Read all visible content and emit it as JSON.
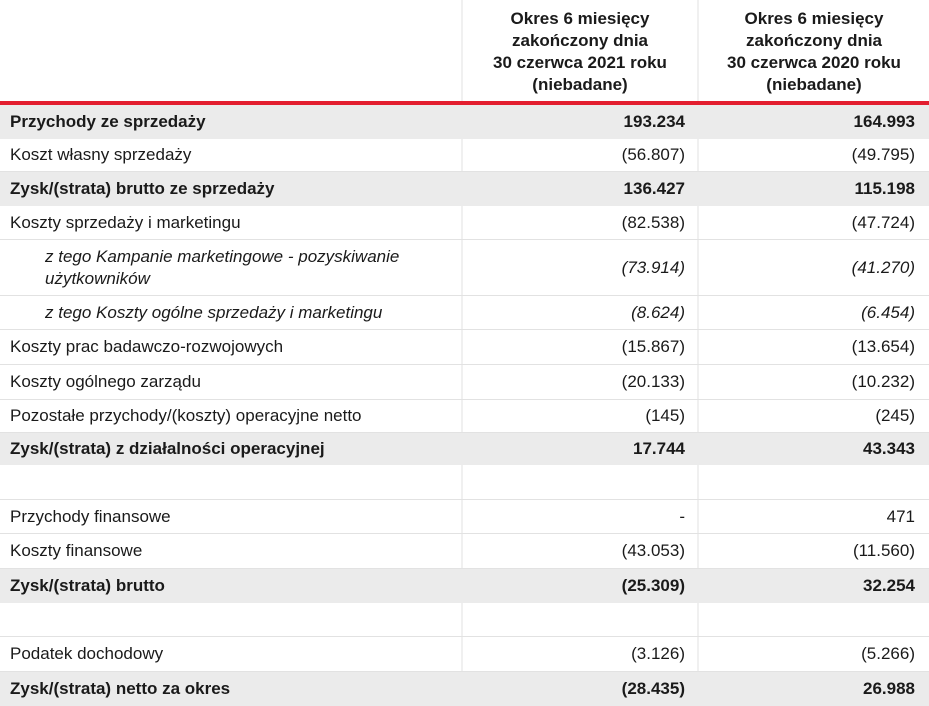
{
  "header": {
    "col1": [
      "Okres 6 miesięcy",
      "zakończony dnia",
      "30 czerwca 2021 roku",
      "(niebadane)"
    ],
    "col2": [
      "Okres 6 miesięcy",
      "zakończony dnia",
      "30 czerwca 2020 roku",
      "(niebadane)"
    ]
  },
  "rows": [
    {
      "label": "Przychody ze sprzedaży",
      "v1": "193.234",
      "v2": "164.993"
    },
    {
      "label": "Koszt własny sprzedaży",
      "v1": "(56.807)",
      "v2": "(49.795)"
    },
    {
      "label": "Zysk/(strata) brutto ze sprzedaży",
      "v1": "136.427",
      "v2": "115.198"
    },
    {
      "label": "Koszty sprzedaży i marketingu",
      "v1": "(82.538)",
      "v2": "(47.724)"
    },
    {
      "label": "z tego Kampanie marketingowe - pozyskiwanie użytkowników",
      "v1": "(73.914)",
      "v2": "(41.270)"
    },
    {
      "label": "z tego Koszty ogólne sprzedaży i marketingu",
      "v1": "(8.624)",
      "v2": "(6.454)"
    },
    {
      "label": "Koszty prac badawczo-rozwojowych",
      "v1": "(15.867)",
      "v2": "(13.654)"
    },
    {
      "label": "Koszty ogólnego zarządu",
      "v1": "(20.133)",
      "v2": "(10.232)"
    },
    {
      "label": "Pozostałe przychody/(koszty) operacyjne netto",
      "v1": "(145)",
      "v2": "(245)"
    },
    {
      "label": "Zysk/(strata) z działalności operacyjnej",
      "v1": "17.744",
      "v2": "43.343"
    },
    {
      "label": "",
      "v1": "",
      "v2": ""
    },
    {
      "label": "Przychody finansowe",
      "v1": "-",
      "v2": "471"
    },
    {
      "label": "Koszty finansowe",
      "v1": "(43.053)",
      "v2": "(11.560)"
    },
    {
      "label": "Zysk/(strata) brutto",
      "v1": "(25.309)",
      "v2": "32.254"
    },
    {
      "label": "",
      "v1": "",
      "v2": ""
    },
    {
      "label": "Podatek dochodowy",
      "v1": "(3.126)",
      "v2": "(5.266)"
    },
    {
      "label": "Zysk/(strata) netto za okres",
      "v1": "(28.435)",
      "v2": "26.988"
    }
  ]
}
